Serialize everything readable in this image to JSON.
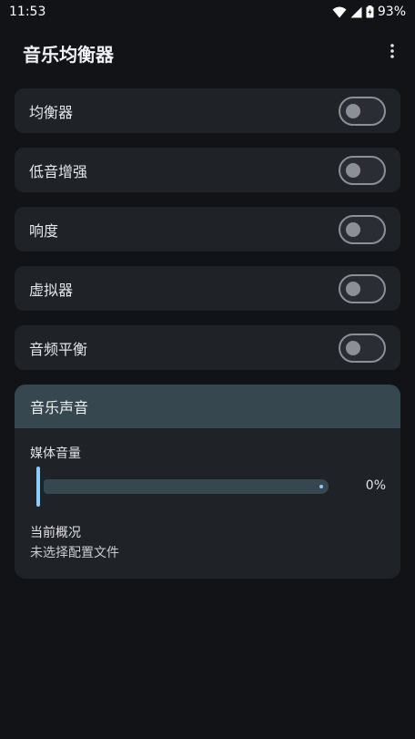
{
  "status_bar": {
    "time": "11:53",
    "battery": "93%",
    "icons": [
      "wifi-icon",
      "signal-icon",
      "battery-icon"
    ]
  },
  "app_bar": {
    "title": "音乐均衡器",
    "menu_icon": "more-vertical-icon"
  },
  "toggles": [
    {
      "label": "均衡器",
      "on": false
    },
    {
      "label": "低音增强",
      "on": false
    },
    {
      "label": "响度",
      "on": false
    },
    {
      "label": "虚拟器",
      "on": false
    },
    {
      "label": "音频平衡",
      "on": false
    }
  ],
  "music_card": {
    "header": "音乐声音",
    "volume_label": "媒体音量",
    "volume_value": "0%",
    "volume_level": 0,
    "profile_label": "当前概况",
    "profile_value": "未选择配置文件"
  },
  "colors": {
    "background": "#111316",
    "surface": "#1f2227",
    "header": "#37474f",
    "accent": "#90caf9",
    "toggle_off": "#8b9097"
  }
}
